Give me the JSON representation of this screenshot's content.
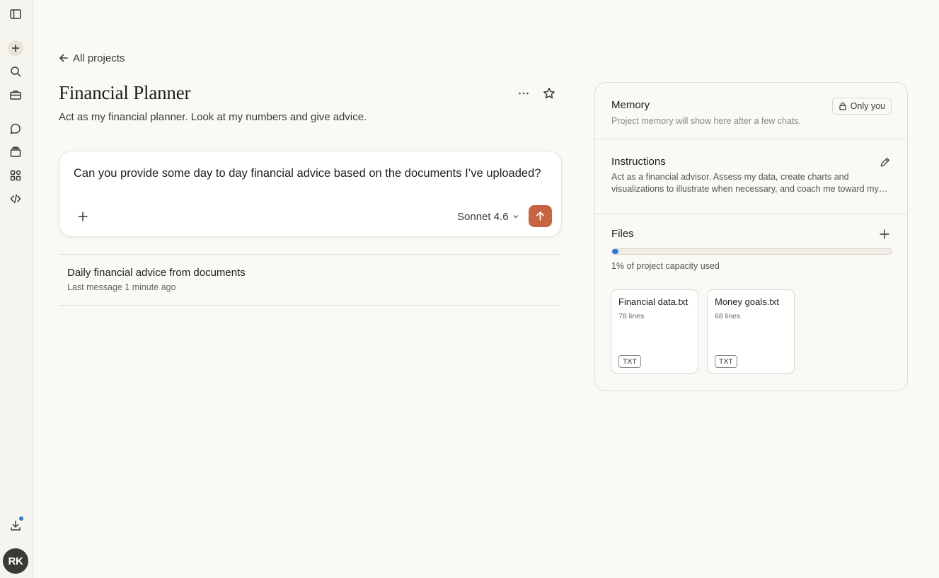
{
  "sidebar": {
    "icons": [
      "sidebar-toggle-icon",
      "plus-icon",
      "search-icon",
      "briefcase-icon",
      "chat-bubble-icon",
      "stack-icon",
      "apps-icon",
      "code-icon",
      "download-icon"
    ],
    "avatar_initials": "RK",
    "notification_color": "#2f7bd8"
  },
  "header": {
    "back_label": "All projects",
    "title": "Financial Planner",
    "description": "Act as my financial planner. Look at my numbers and give advice."
  },
  "composer": {
    "text": "Can you provide some day to day financial advice based on the documents I’ve uploaded?",
    "model": "Sonnet 4.6",
    "send_color": "#c96442"
  },
  "chats": [
    {
      "title": "Daily financial advice from documents",
      "meta": "Last message 1 minute ago"
    }
  ],
  "panel": {
    "memory": {
      "title": "Memory",
      "visibility": "Only you",
      "subtitle": "Project memory will show here after a few chats."
    },
    "instructions": {
      "title": "Instructions",
      "text": "Act as a financial advisor. Assess my data, create charts and visualizations to illustrate when necessary, and coach me toward my…"
    },
    "files": {
      "title": "Files",
      "capacity_used_fraction": 0.01,
      "capacity_label": "1% of project capacity used",
      "items": [
        {
          "name": "Financial data.txt",
          "lines": "78 lines",
          "type": "TXT"
        },
        {
          "name": "Money goals.txt",
          "lines": "68 lines",
          "type": "TXT"
        }
      ]
    }
  }
}
